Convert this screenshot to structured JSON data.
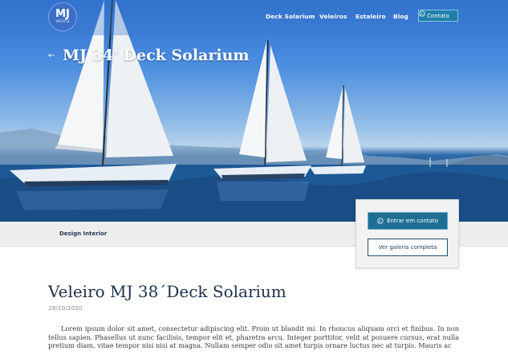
{
  "header": {
    "logo_text": "MJ",
    "logo_subtext": "YACHTS",
    "nav": [
      {
        "label": "Deck Solarium"
      },
      {
        "label": "Veleiros"
      },
      {
        "label": "Estaleiro"
      },
      {
        "label": "Blog"
      }
    ],
    "contact_label": "Contato"
  },
  "hero": {
    "back_icon": "arrow-left-icon",
    "title": "MJ 34' Deck Solarium"
  },
  "tabs": {
    "design_label": "Design Interior"
  },
  "side_card": {
    "contact_label": "Entrar em contato",
    "gallery_label": "Ver galeria completa"
  },
  "post": {
    "title": "Veleiro MJ 38´Deck Solarium",
    "date": "28/10/2020",
    "body": "Lorem ipsum dolor sit amet, consectetur adipiscing elit. Proin ut blandit mi. In rhoncus aliquam orci et finibus. In non tellus sapien. Phasellus ut nunc facilisis, tempor elit et, pharetra arcu. Integer porttitor, velit at posuere cursus, erat nulla pretium diam, vitae tempor nisi nisi at magna. Nullam semper odio sit amet turpis ornare luctus nec at turpis. Mauris ac"
  },
  "colors": {
    "accent": "#1f7fa8",
    "title_text": "#1d3049"
  }
}
